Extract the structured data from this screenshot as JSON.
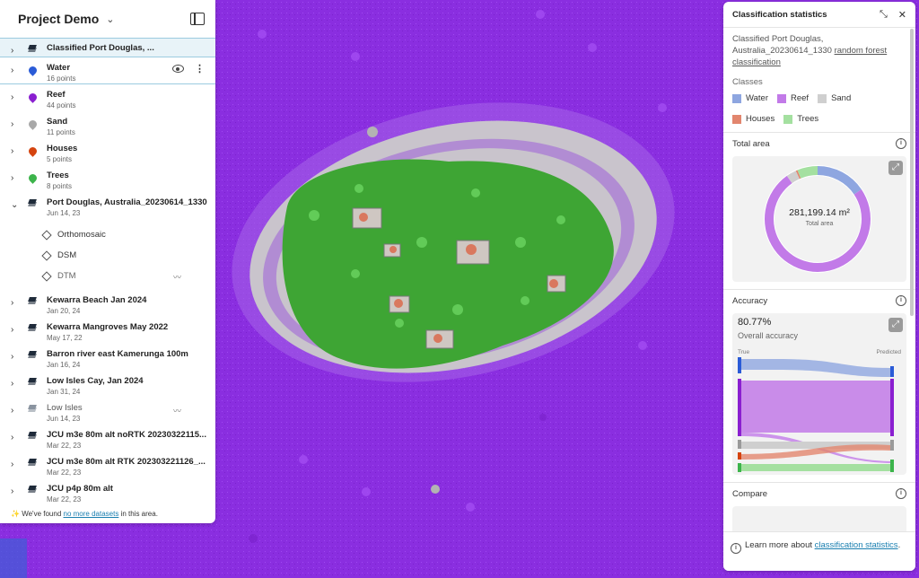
{
  "colors": {
    "water": "#8ea6e0",
    "reef": "#c27ae8",
    "sand": "#cfcfcf",
    "houses": "#e2866e",
    "trees": "#a4e0a0",
    "map_bg": "#8a2ee0"
  },
  "project": {
    "title": "Project Demo"
  },
  "datasets": [
    {
      "name": "Classified Port Douglas, ...",
      "type": "stack",
      "selected": true
    },
    {
      "name": "Water",
      "sub": "16 points",
      "type": "pin",
      "color": "#2a5bd7",
      "hover": true
    },
    {
      "name": "Reef",
      "sub": "44 points",
      "type": "pin",
      "color": "#8a1fd0"
    },
    {
      "name": "Sand",
      "sub": "11 points",
      "type": "pin",
      "color": "#a8a8a8"
    },
    {
      "name": "Houses",
      "sub": "5 points",
      "type": "pin",
      "color": "#d5440f"
    },
    {
      "name": "Trees",
      "sub": "8 points",
      "type": "pin",
      "color": "#3cb44b"
    },
    {
      "name": "Port Douglas, Australia_20230614_1330",
      "sub": "Jun 14, 23",
      "type": "stack",
      "expanded": true
    },
    {
      "name": "Kewarra Beach Jan 2024",
      "sub": "Jan 20, 24",
      "type": "stack"
    },
    {
      "name": "Kewarra Mangroves May 2022",
      "sub": "May 17, 22",
      "type": "stack"
    },
    {
      "name": "Barron river east Kamerunga 100m",
      "sub": "Jan 16, 24",
      "type": "stack"
    },
    {
      "name": "Low Isles Cay, Jan 2024",
      "sub": "Jan 31, 24",
      "type": "stack"
    },
    {
      "name": "Low Isles",
      "sub": "Jun 14, 23",
      "type": "stack",
      "muted": true
    },
    {
      "name": "JCU m3e 80m alt noRTK 20230322115...",
      "sub": "Mar 22, 23",
      "type": "stack"
    },
    {
      "name": "JCU m3e 80m alt RTK 202303221126_...",
      "sub": "Mar 22, 23",
      "type": "stack"
    },
    {
      "name": "JCU p4p 80m alt",
      "sub": "Mar 22, 23",
      "type": "stack"
    }
  ],
  "sublayers": [
    "Orthomosaic",
    "DSM",
    "DTM"
  ],
  "found": {
    "prefix": "We've found",
    "link": "no more datasets",
    "suffix": "in this area."
  },
  "stats": {
    "title": "Classification statistics",
    "desc_text": "Classified Port Douglas, Australia_20230614_1330",
    "desc_link": "random forest classification",
    "classes_label": "Classes",
    "classes": [
      {
        "name": "Water",
        "color": "#8ea6e0"
      },
      {
        "name": "Reef",
        "color": "#c27ae8"
      },
      {
        "name": "Sand",
        "color": "#cfcfcf"
      },
      {
        "name": "Houses",
        "color": "#e2866e"
      },
      {
        "name": "Trees",
        "color": "#a4e0a0"
      }
    ],
    "total_area_label": "Total area",
    "total_area_value": "281,199.14 m²",
    "total_area_caption": "Total area",
    "donut_fractions": [
      0.15,
      0.72,
      0.03,
      0.005,
      0.06
    ],
    "accuracy_label": "Accuracy",
    "accuracy_value": "80.77%",
    "accuracy_caption": "Overall accuracy",
    "true_label": "True",
    "pred_label": "Predicted",
    "compare_label": "Compare",
    "footer_text": "Learn more about",
    "footer_link": "classification statistics",
    "footer_end": "."
  }
}
